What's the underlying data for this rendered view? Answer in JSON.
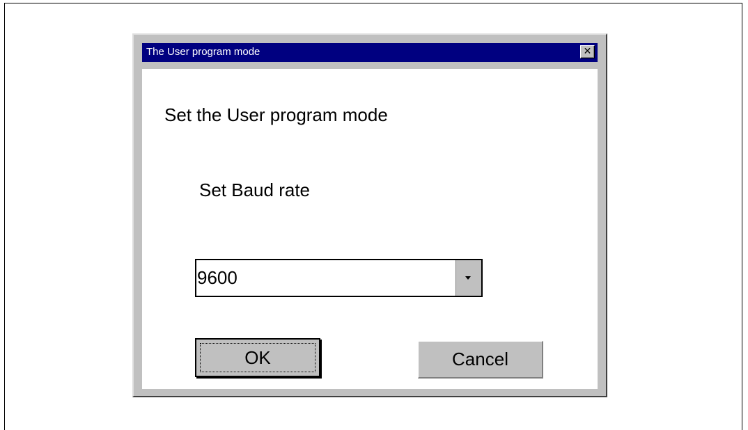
{
  "dialog": {
    "title": "The User program mode",
    "close_glyph": "✕",
    "close_icon": "close-icon",
    "heading": "Set the User program mode",
    "baud_label": "Set Baud rate",
    "baud_value": "9600",
    "dropdown_icon": "chevron-down-icon",
    "ok_label": "OK",
    "cancel_label": "Cancel"
  },
  "colors": {
    "titlebar": "#000080",
    "title_text": "#ffffff",
    "dialog_face": "#c0c0c0",
    "client": "#ffffff"
  }
}
